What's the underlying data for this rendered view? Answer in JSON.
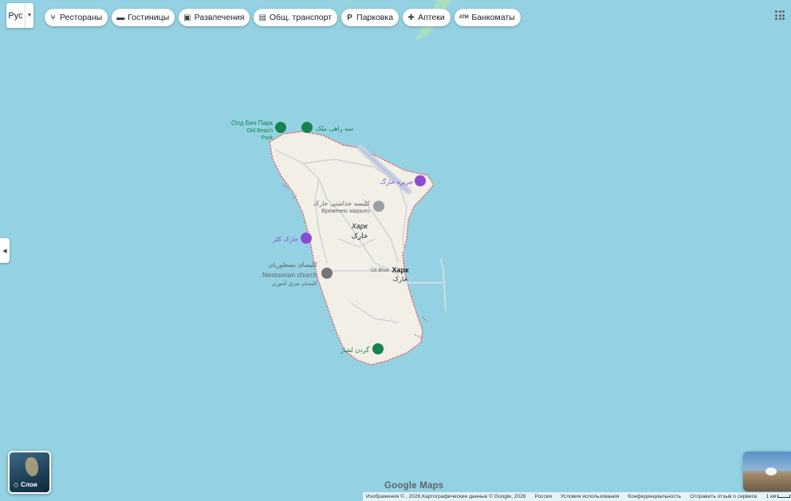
{
  "language_selector": {
    "label": "Рус"
  },
  "chips": [
    {
      "icon": "restaurant-icon",
      "glyph": "⑂",
      "label": "Рестораны"
    },
    {
      "icon": "hotel-icon",
      "glyph": "▬",
      "label": "Гостиницы"
    },
    {
      "icon": "camera-icon",
      "glyph": "▣",
      "label": "Развлечения"
    },
    {
      "icon": "bus-icon",
      "glyph": "▤",
      "label": "Общ. транспорт"
    },
    {
      "icon": "parking-icon",
      "glyph": "P",
      "label": "Парковка"
    },
    {
      "icon": "pharmacy-icon",
      "glyph": "✚",
      "label": "Аптеки"
    },
    {
      "icon": "atm-icon",
      "glyph": "ATM",
      "label": "Банкоматы"
    }
  ],
  "map_labels": {
    "old_beach_park_ru": "Олд Бич Парк",
    "old_beach_park_en_1": "Old Beach",
    "old_beach_park_en_2": "Park",
    "sea_park": "سه راهی ملک",
    "kharg_island_fa": "جزیره خارگ",
    "church_fa": "کلیسه خداشتی خارک",
    "temporarily_closed": "Временно закрыто",
    "kharg_ru": "Харк",
    "kharg_fa": "خارک",
    "fort": "خارک کلر",
    "nestorian_fa": "کلیسای نسطوریان",
    "nestorian_en": "Nestoorian church",
    "nestorian_fa2": "کلیسای شرق آشوری",
    "oil_blvd": "Oil Blvd",
    "kharg_town_ru": "Харк",
    "kharg_town_fa": "خارک",
    "green_park": "گردن لشار"
  },
  "layers_button": {
    "label": "Слои"
  },
  "google_logo": "Google Maps",
  "footer": {
    "imagery": "Изображения © , 2026,Картографические данные © Google, 2026",
    "region": "Россия",
    "terms": "Условия использования",
    "privacy": "Конфиденциальность",
    "feedback": "Отправить отзыв о сервисе",
    "scale": "1 км"
  },
  "colors": {
    "water": "#94d2e3",
    "land": "#f2efe6",
    "boundary": "#e0495a",
    "poi_green": "#178250",
    "poi_purple": "#8d4bd1",
    "poi_gray": "#757575",
    "road": "#c8ccd4"
  }
}
